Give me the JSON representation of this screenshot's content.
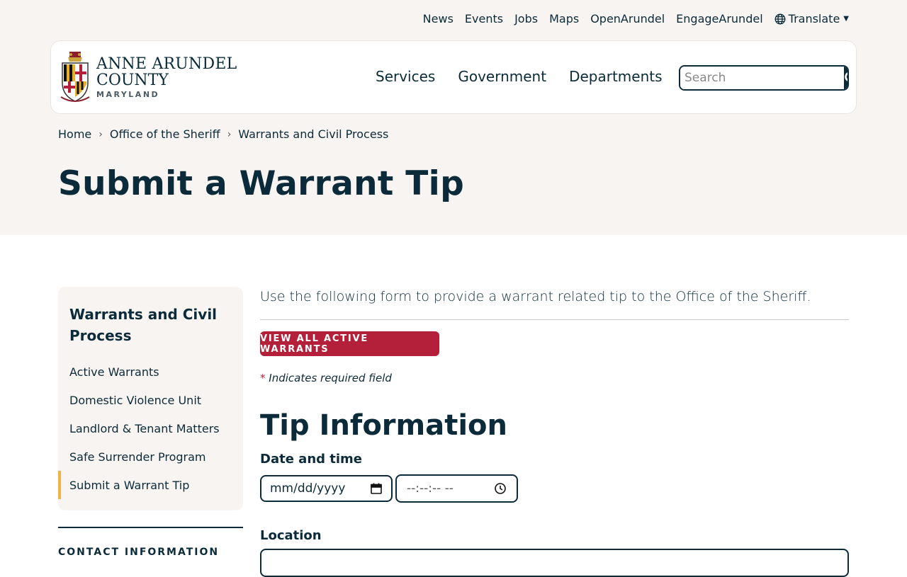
{
  "utility_nav": {
    "items": [
      "News",
      "Events",
      "Jobs",
      "Maps",
      "OpenArundel",
      "EngageArundel"
    ],
    "translate_label": "Translate"
  },
  "logo": {
    "line1": "ANNE ARUNDEL",
    "line2": "COUNTY",
    "line3": "MARYLAND"
  },
  "main_nav": {
    "items": [
      "Services",
      "Government",
      "Departments"
    ]
  },
  "search": {
    "placeholder": "Search"
  },
  "breadcrumb": {
    "items": [
      "Home",
      "Office of the Sheriff",
      "Warrants and Civil Process"
    ]
  },
  "page_title": "Submit a Warrant Tip",
  "sidebar": {
    "title": "Warrants and Civil Process",
    "items": [
      "Active Warrants",
      "Domestic Violence Unit",
      "Landlord & Tenant Matters",
      "Safe Surrender Program",
      "Submit a Warrant Tip"
    ],
    "active_item": "Submit a Warrant Tip",
    "contact_title": "CONTACT INFORMATION"
  },
  "content": {
    "intro": "Use the following form to provide a warrant related tip to the Office of the Sheriff.",
    "warrants_button": "VIEW ALL ACTIVE WARRANTS",
    "required_star": "*",
    "required_note": "Indicates required field",
    "section_title": "Tip Information",
    "datetime_label": "Date and time",
    "date_placeholder": "mm/dd/yyyy",
    "time_placeholder": "--:--:-- --",
    "location_label": "Location"
  },
  "colors": {
    "navy": "#0b2b3a",
    "accent_red": "#b41f3a",
    "active_marker": "#f5b04a",
    "hero_bg": "#f8f4f1"
  }
}
